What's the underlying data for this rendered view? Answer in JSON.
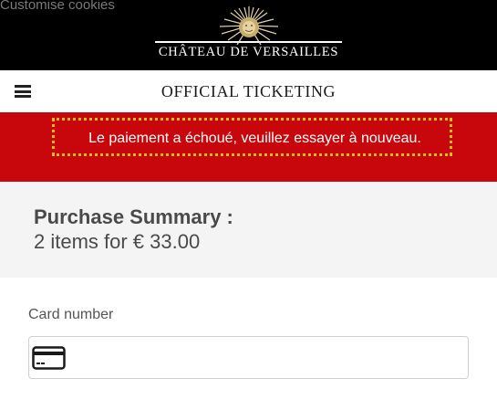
{
  "header": {
    "cookie_link": "Customise cookies",
    "logo_text": "CHÂTEAU DE VERSAILLES",
    "logo_icon": "sun-emblem-icon"
  },
  "nav": {
    "menu_icon": "hamburger-icon",
    "title": "OFFICIAL TICKETING"
  },
  "error": {
    "message": "Le paiement a échoué, veuillez essayer à nouveau."
  },
  "summary": {
    "title": "Purchase Summary :",
    "detail": "2 items for € 33.00"
  },
  "payment": {
    "card_label": "Card number",
    "card_value": "",
    "card_icon": "credit-card-icon"
  },
  "colors": {
    "header_bg": "#000000",
    "error_bg": "#c8070d",
    "error_border": "#f2c200",
    "summary_bg": "#f4f4f4"
  }
}
